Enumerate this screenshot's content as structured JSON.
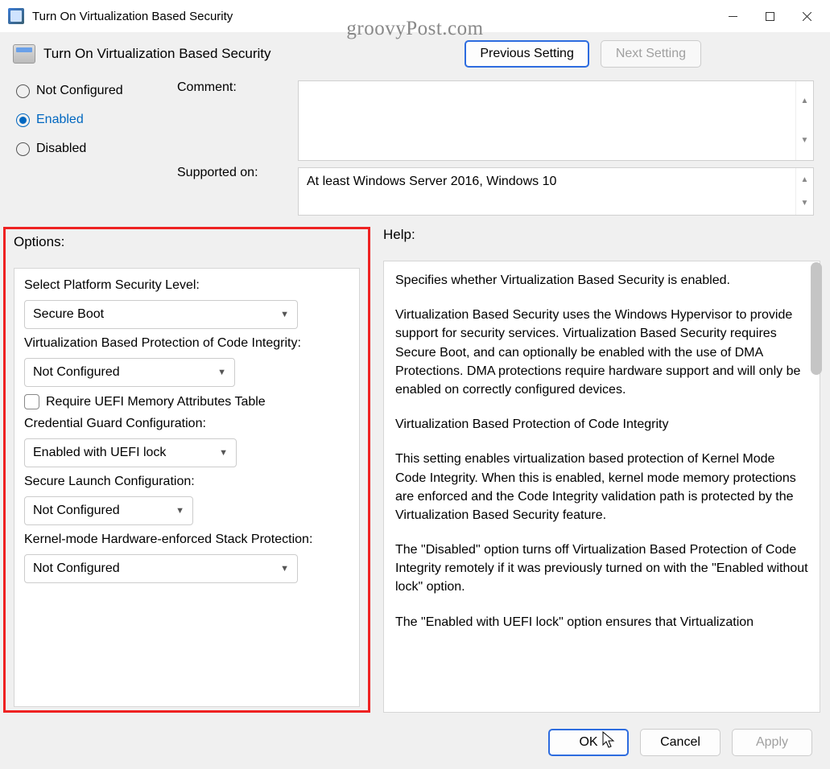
{
  "window": {
    "title": "Turn On Virtualization Based Security"
  },
  "watermark": "groovyPost.com",
  "header": {
    "title": "Turn On Virtualization Based Security"
  },
  "nav": {
    "prev": "Previous Setting",
    "next": "Next Setting"
  },
  "state": {
    "radios": {
      "not_configured": "Not Configured",
      "enabled": "Enabled",
      "disabled": "Disabled",
      "selected": "enabled"
    },
    "comment_label": "Comment:",
    "comment_value": "",
    "supported_label": "Supported on:",
    "supported_value": "At least Windows Server 2016, Windows 10"
  },
  "options": {
    "title": "Options:",
    "platform_label": "Select Platform Security Level:",
    "platform_value": "Secure Boot",
    "vbpci_label": "Virtualization Based Protection of Code Integrity:",
    "vbpci_value": "Not Configured",
    "uefi_checkbox": "Require UEFI Memory Attributes Table",
    "credguard_label": "Credential Guard Configuration:",
    "credguard_value": "Enabled with UEFI lock",
    "securelaunch_label": "Secure Launch Configuration:",
    "securelaunch_value": "Not Configured",
    "kernel_label": "Kernel-mode Hardware-enforced Stack Protection:",
    "kernel_value": "Not Configured"
  },
  "help": {
    "title": "Help:",
    "p1": "Specifies whether Virtualization Based Security is enabled.",
    "p2": "Virtualization Based Security uses the Windows Hypervisor to provide support for security services. Virtualization Based Security requires Secure Boot, and can optionally be enabled with the use of DMA Protections. DMA protections require hardware support and will only be enabled on correctly configured devices.",
    "p3": "Virtualization Based Protection of Code Integrity",
    "p4": "This setting enables virtualization based protection of Kernel Mode Code Integrity. When this is enabled, kernel mode memory protections are enforced and the Code Integrity validation path is protected by the Virtualization Based Security feature.",
    "p5": "The \"Disabled\" option turns off Virtualization Based Protection of Code Integrity remotely if it was previously turned on with the \"Enabled without lock\" option.",
    "p6": "The \"Enabled with UEFI lock\" option ensures that Virtualization"
  },
  "footer": {
    "ok": "OK",
    "cancel": "Cancel",
    "apply": "Apply"
  }
}
